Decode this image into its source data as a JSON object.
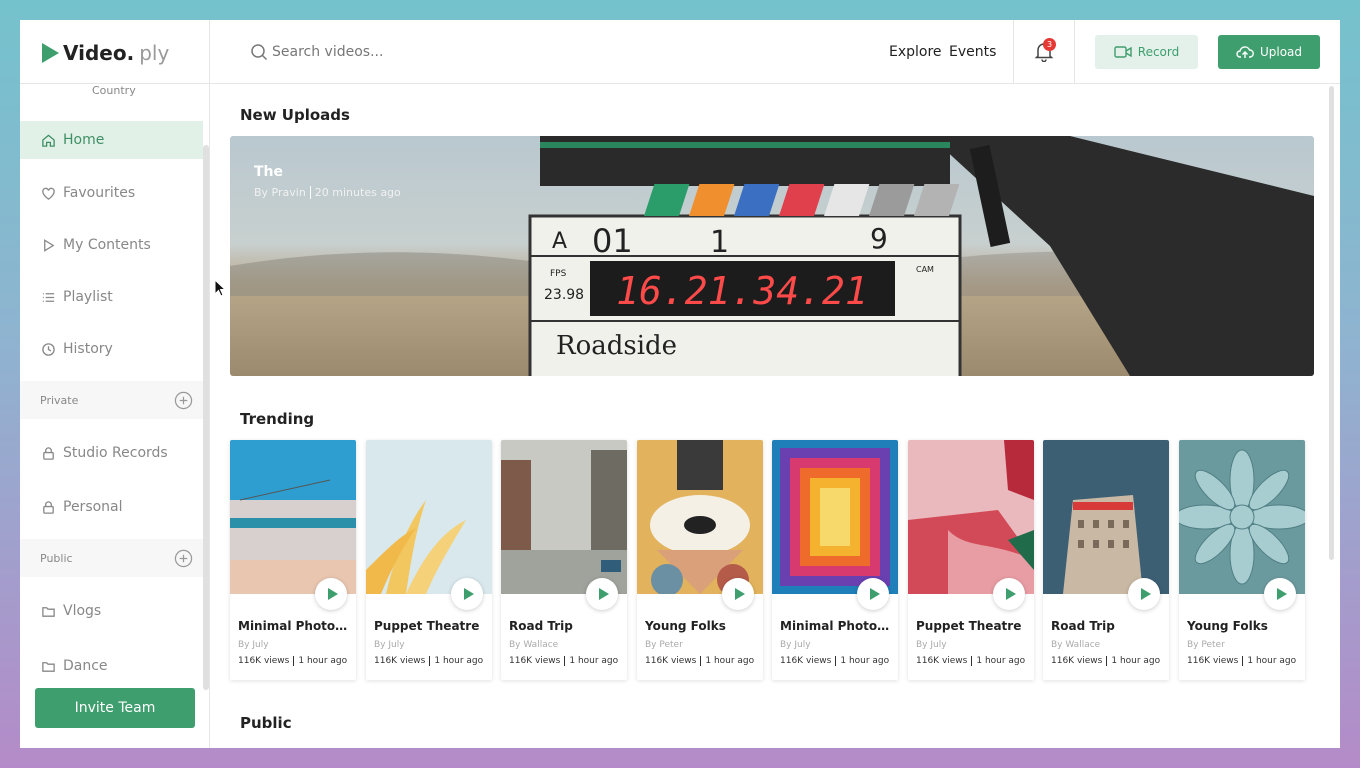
{
  "app": {
    "logo_text": "Video.",
    "logo_text_suffix": "ply",
    "country_label": "Country"
  },
  "sidebar": {
    "items": [
      {
        "label": "Home",
        "icon": "home-icon",
        "active": true
      },
      {
        "label": "Favourites",
        "icon": "heart-icon"
      },
      {
        "label": "My Contents",
        "icon": "play-outline-icon"
      },
      {
        "label": "Playlist",
        "icon": "list-icon"
      },
      {
        "label": "History",
        "icon": "clock-icon"
      }
    ],
    "private_label": "Private",
    "private_items": [
      {
        "label": "Studio Records",
        "icon": "lock-icon"
      },
      {
        "label": "Personal",
        "icon": "lock-icon"
      }
    ],
    "public_label": "Public",
    "public_items": [
      {
        "label": "Vlogs",
        "icon": "folder-icon"
      },
      {
        "label": "Dance",
        "icon": "folder-icon"
      }
    ],
    "invite_label": "Invite Team"
  },
  "header": {
    "search_placeholder": "Search videos...",
    "explore_label": "Explore",
    "events_label": "Events",
    "notification_count": "3",
    "record_label": "Record",
    "upload_label": "Upload"
  },
  "sections": {
    "new_uploads_title": "New Uploads",
    "trending_title": "Trending",
    "public_title": "Public"
  },
  "hero": {
    "title": "The",
    "author": "By Pravin",
    "time": "20 minutes ago",
    "slate_roll": "A",
    "slate_scene": "01",
    "slate_take": "1",
    "slate_take2": "9",
    "slate_fps_label": "FPS",
    "slate_fps": "23.98",
    "slate_timecode": "16.21.34.21",
    "slate_cam": "CAM",
    "slate_prod": "Roadside"
  },
  "trending": [
    {
      "title": "Minimal Photography",
      "by": "By July",
      "views": "116K views",
      "time": "1 hour ago"
    },
    {
      "title": "Puppet Theatre",
      "by": "By July",
      "views": "116K views",
      "time": "1 hour ago"
    },
    {
      "title": "Road Trip",
      "by": "By Wallace",
      "views": "116K views",
      "time": "1 hour ago"
    },
    {
      "title": "Young Folks",
      "by": "By Peter",
      "views": "116K views",
      "time": "1 hour ago"
    },
    {
      "title": "Minimal Photography",
      "by": "By July",
      "views": "116K views",
      "time": "1 hour ago"
    },
    {
      "title": "Puppet Theatre",
      "by": "By July",
      "views": "116K views",
      "time": "1 hour ago"
    },
    {
      "title": "Road Trip",
      "by": "By Wallace",
      "views": "116K views",
      "time": "1 hour ago"
    },
    {
      "title": "Young Folks",
      "by": "By Peter",
      "views": "116K views",
      "time": "1 hour ago"
    }
  ],
  "colors": {
    "accent": "#3f9e6e",
    "active_bg": "#e1f1e8",
    "badge": "#e53935"
  }
}
